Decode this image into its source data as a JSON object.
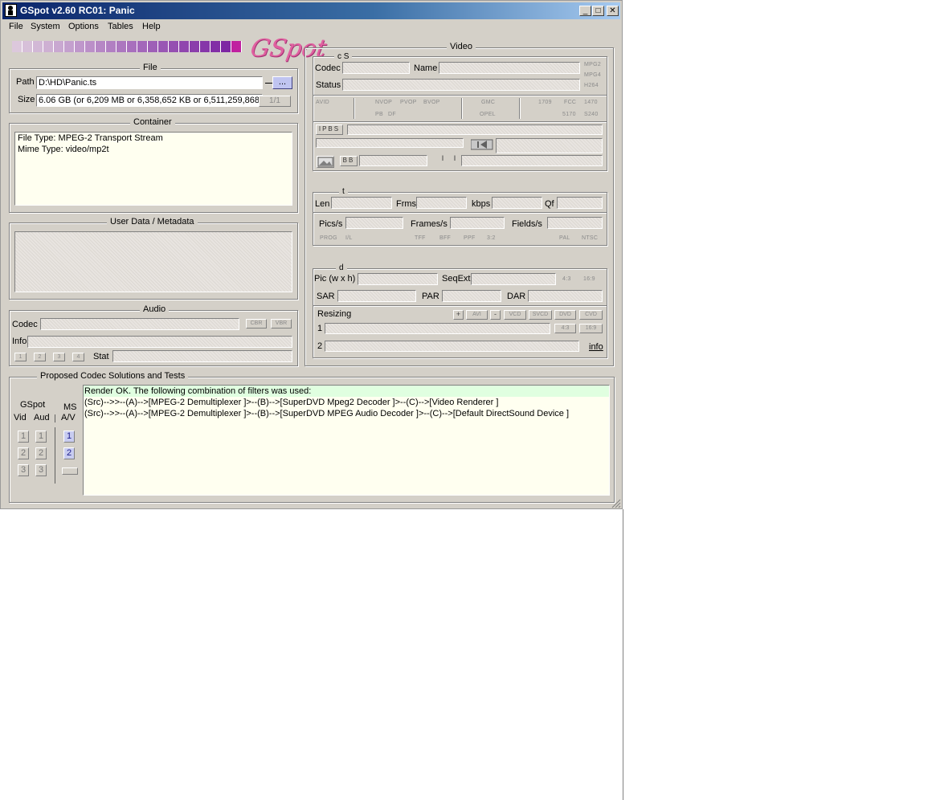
{
  "window": {
    "title": "GSpot v2.60 RC01: Panic",
    "min": "_",
    "max": "□",
    "close": "✕"
  },
  "menu": [
    "File",
    "System",
    "Options",
    "Tables",
    "Help"
  ],
  "logo_text": "GSpot",
  "colors": {
    "accent": "#7a2090",
    "title_bar": "#0a246a",
    "highlight_row": "#e0ffe0"
  },
  "file": {
    "title": "File",
    "path_label": "Path",
    "path_value": "D:\\HD\\Panic.ts",
    "browse_label": "...",
    "size_label": "Size",
    "size_value": "6.06 GB (or 6,209 MB or 6,358,652 KB or 6,511,259,868",
    "counter": "1/1"
  },
  "container": {
    "title": "Container",
    "lines": [
      "File Type: MPEG-2 Transport Stream",
      "Mime Type: video/mp2t"
    ]
  },
  "user_data": {
    "title": "User Data / Metadata"
  },
  "audio": {
    "title": "Audio",
    "codec_label": "Codec",
    "cbr": "CBR",
    "vbr": "VBR",
    "info_label": "Info",
    "stream_buttons": [
      "1",
      "2",
      "3",
      "4"
    ],
    "stat_label": "Stat"
  },
  "video": {
    "title": "Video",
    "cs_title": "c  S",
    "codec_label": "Codec",
    "name_label": "Name",
    "status_label": "Status",
    "codec_flags": [
      "MPG2",
      "MPG4",
      "H264"
    ],
    "flags_row1": [
      "AVID",
      "NVOP",
      "PVOP",
      "BVOP",
      "GMC",
      "1709",
      "FCC",
      "1470"
    ],
    "flags_row2": [
      "PB",
      "DF",
      "OPEL",
      "5170",
      "S240"
    ],
    "ipbs": "IPBS",
    "bb": "BB",
    "i1": "I",
    "i2": "I",
    "t_title": "t",
    "len_label": "Len",
    "frms_label": "Frms",
    "kbps_label": "kbps",
    "qf_label": "Qf",
    "pics_label": "Pics/s",
    "frames_label": "Frames/s",
    "fields_label": "Fields/s",
    "scan_flags": [
      "PROG",
      "I/L",
      "TFF",
      "BFF",
      "PPF",
      "3:2",
      "PAL",
      "NTSC"
    ],
    "d_title": "d",
    "pic_label": "Pic (w x h)",
    "seqext_label": "SeqExt",
    "aspect_flags": [
      "4:3",
      "16:9"
    ],
    "sar_label": "SAR",
    "par_label": "PAR",
    "dar_label": "DAR",
    "resizing_label": "Resizing",
    "resize_buttons": [
      "+",
      "AVI",
      "-",
      "VCD",
      "SVCD",
      "DVD",
      "CVD"
    ],
    "row1_label": "1",
    "row2_label": "2",
    "row1_flags": [
      "4:3",
      "16:9"
    ],
    "info_link": "info"
  },
  "codec_solutions": {
    "title": "Proposed Codec Solutions and Tests",
    "gspot_label": "GSpot",
    "ms_label": "MS",
    "vid_label": "Vid",
    "aud_label": "Aud",
    "av_label": "A/V",
    "vid_buttons": [
      "1",
      "2",
      "3"
    ],
    "aud_buttons": [
      "1",
      "2",
      "3"
    ],
    "ms_buttons": [
      "1",
      "2"
    ],
    "lines": [
      "Render OK. The following combination of filters was used:",
      "(Src)-->>--(A)-->[MPEG-2 Demultiplexer ]>--(B)-->[SuperDVD Mpeg2 Decoder ]>--(C)-->[Video Renderer ]",
      "(Src)-->>--(A)-->[MPEG-2 Demultiplexer ]>--(B)-->[SuperDVD MPEG Audio Decoder ]>--(C)-->[Default DirectSound Device ]"
    ]
  }
}
